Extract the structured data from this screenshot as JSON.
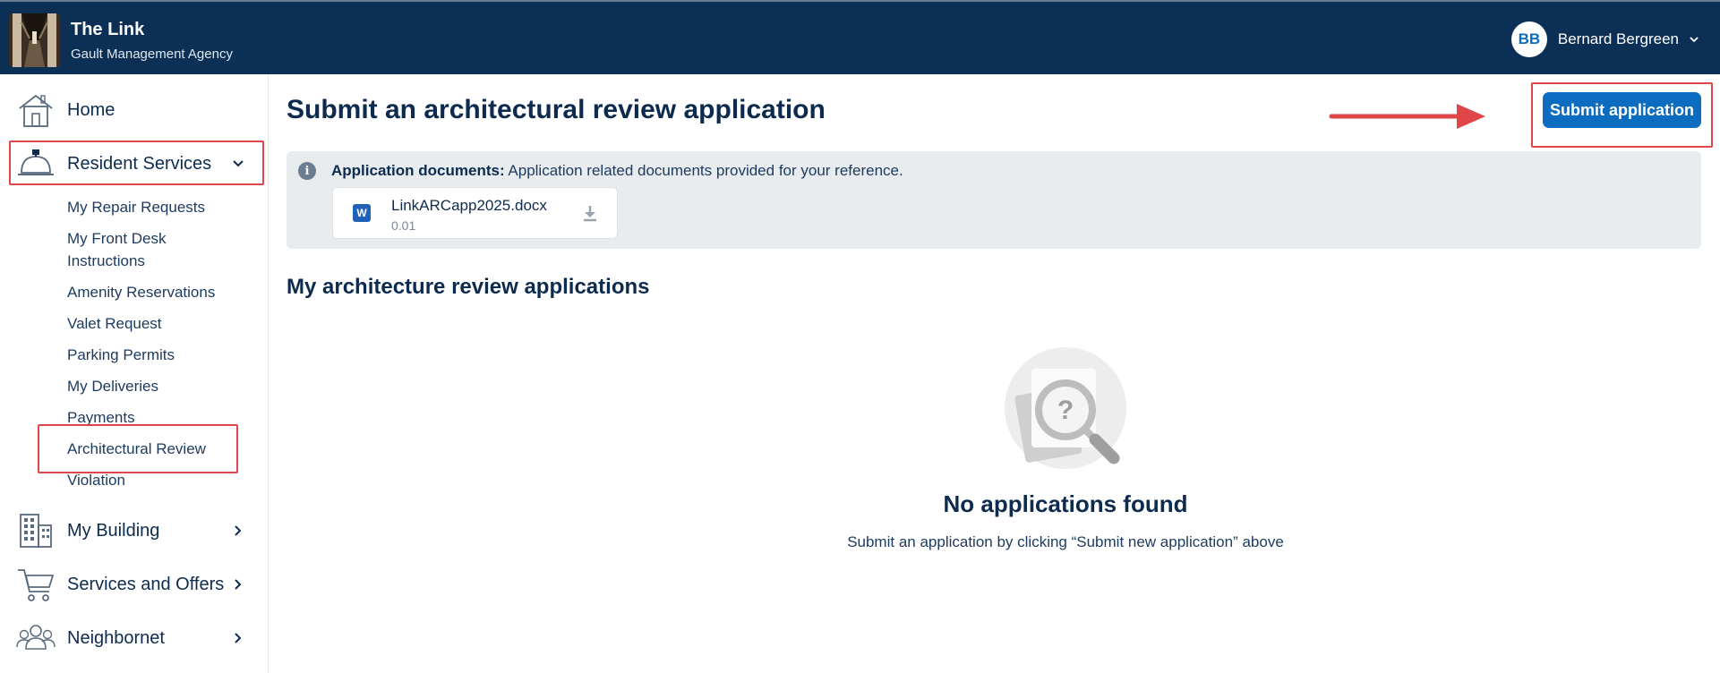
{
  "header": {
    "app_title": "The Link",
    "app_subtitle": "Gault Management Agency",
    "user_initials": "BB",
    "user_name": "Bernard Bergreen"
  },
  "sidebar": {
    "home": "Home",
    "resident_services": "Resident Services",
    "sub_items": [
      "My Repair Requests",
      "My Front Desk",
      "Instructions",
      "Amenity Reservations",
      "Valet Request",
      "Parking Permits",
      "My Deliveries",
      "Payments",
      "Architectural Review",
      "Violation"
    ],
    "my_building": "My Building",
    "services_offers": "Services and Offers",
    "neighbornet": "Neighbornet"
  },
  "main": {
    "title": "Submit an architectural review application",
    "submit_button": "Submit application",
    "info_label": "Application documents:",
    "info_text": " Application related documents provided for your reference.",
    "document": {
      "name": "LinkARCapp2025.docx",
      "size": "0.01",
      "type_letter": "W"
    },
    "section_title": "My architecture review applications",
    "empty_title": "No applications found",
    "empty_subtitle": "Submit an application by clicking “Submit new application” above"
  },
  "colors": {
    "header_bg": "#0b2f55",
    "accent": "#0b6cc0",
    "highlight": "#e0454a",
    "panel_bg": "#e9ecef"
  }
}
